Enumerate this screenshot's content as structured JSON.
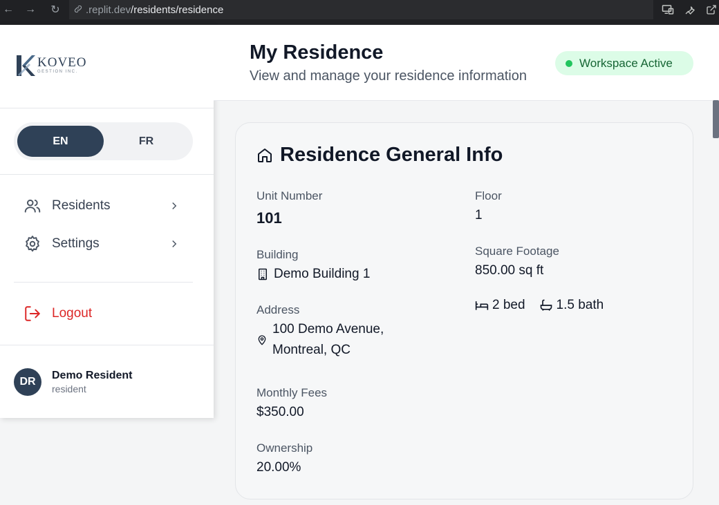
{
  "browser": {
    "url_prefix": ".replit.dev",
    "url_path": "/residents/residence"
  },
  "sidebar": {
    "logo": {
      "word": "KOVEO",
      "sub": "GESTION INC."
    },
    "languages": [
      {
        "label": "EN",
        "active": true
      },
      {
        "label": "FR",
        "active": false
      }
    ],
    "nav": [
      {
        "label": "Residents",
        "icon": "users-icon"
      },
      {
        "label": "Settings",
        "icon": "gear-icon"
      }
    ],
    "logout_label": "Logout",
    "user": {
      "initials": "DR",
      "name": "Demo Resident",
      "role": "resident"
    }
  },
  "header": {
    "title": "My Residence",
    "subtitle": "View and manage your residence information",
    "status": "Workspace Active"
  },
  "card": {
    "title": "Residence General Info",
    "unit_number": {
      "label": "Unit Number",
      "value": "101"
    },
    "floor": {
      "label": "Floor",
      "value": "1"
    },
    "building": {
      "label": "Building",
      "value": "Demo Building 1"
    },
    "square_footage": {
      "label": "Square Footage",
      "value": "850.00 sq ft"
    },
    "beds": "2 bed",
    "baths": "1.5 bath",
    "address": {
      "label": "Address",
      "line1": "100 Demo Avenue,",
      "line2": "Montreal, QC"
    },
    "monthly_fees": {
      "label": "Monthly Fees",
      "value": "$350.00"
    },
    "ownership": {
      "label": "Ownership",
      "value": "20.00%"
    }
  },
  "colors": {
    "brand": "#2f4157",
    "danger": "#dc2626",
    "success_bg": "#dcfce7",
    "success_dot": "#22c55e",
    "success_text": "#166534"
  }
}
